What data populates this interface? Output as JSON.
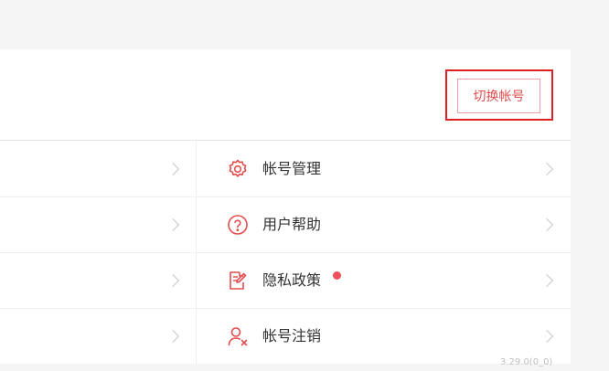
{
  "header": {
    "switch_account_label": "切换帐号"
  },
  "menu": {
    "items": [
      {
        "label": "帐号管理",
        "icon": "gear-icon",
        "has_badge": false
      },
      {
        "label": "用户帮助",
        "icon": "help-icon",
        "has_badge": false
      },
      {
        "label": "隐私政策",
        "icon": "privacy-document-icon",
        "has_badge": true
      },
      {
        "label": "帐号注销",
        "icon": "user-remove-icon",
        "has_badge": false
      }
    ]
  },
  "footer": {
    "version": "3.29.0(0_0)"
  },
  "colors": {
    "accent": "#e34d4d",
    "badge": "#f0505a",
    "highlight_border": "#e02020"
  }
}
